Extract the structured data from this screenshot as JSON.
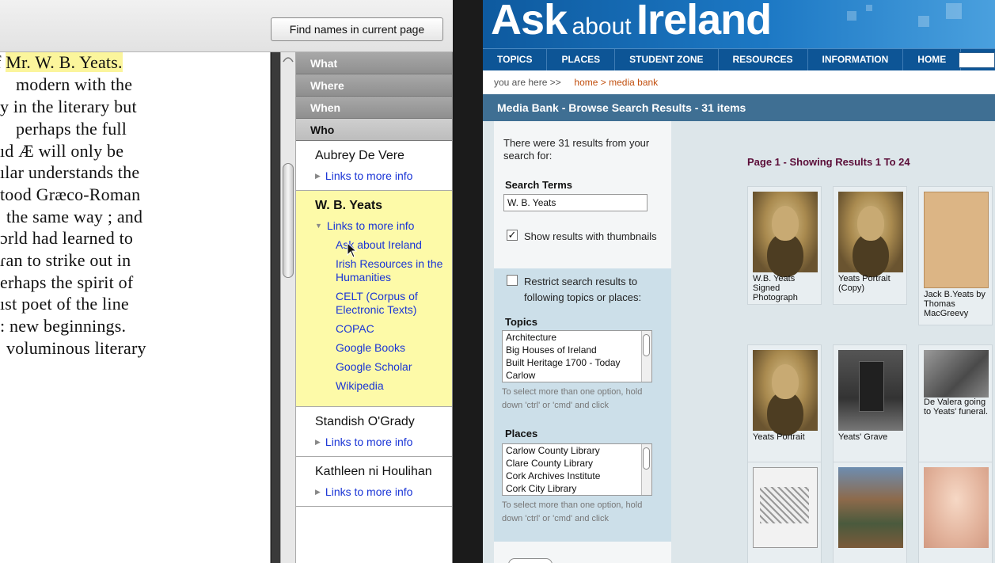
{
  "toolbar": {
    "find_button_label": "Find names in current page"
  },
  "document": {
    "highlighted_name": "Mr. W. B. Yeats.",
    "lines": [
      "f ",
      " modern with the",
      "y in the literary but",
      " perhaps the full",
      "ıd Æ will only be",
      "ılar understands the",
      "tood Græco-Roman",
      " the same way ; and",
      "ɔrld had learned to",
      "ɾan to strike out in",
      "erhaps the spirit of",
      "ıst poet of the line",
      ": new beginnings.",
      " voluminous literary"
    ]
  },
  "facets": {
    "headers": [
      "What",
      "Where",
      "When",
      "Who"
    ],
    "active": "Who",
    "names": [
      {
        "name": "Aubrey De Vere",
        "link": "Links to more info"
      },
      {
        "name": "W. B. Yeats",
        "link": "Links to more info",
        "expanded": true,
        "sublinks": [
          "Ask about Ireland",
          "Irish Resources in the Humanities",
          "CELT (Corpus of Electronic Texts)",
          "COPAC",
          "Google Books",
          "Google Scholar",
          "Wikipedia"
        ]
      },
      {
        "name": "Standish O'Grady",
        "link": "Links to more info"
      },
      {
        "name": "Kathleen ni Houlihan",
        "link": "Links to more info"
      }
    ]
  },
  "site": {
    "logo": {
      "ask": "Ask",
      "about": "about",
      "ireland": "Ireland"
    },
    "nav": [
      "TOPICS",
      "PLACES",
      "STUDENT ZONE",
      "RESOURCES",
      "INFORMATION",
      "HOME"
    ],
    "breadcrumb": {
      "prefix": "you are here >>",
      "home": "home",
      "sep": ">",
      "current": "media bank"
    },
    "results_title": "Media Bank - Browse Search Results - 31 items",
    "search": {
      "intro": "There were 31 results from your search for:",
      "terms_label": "Search Terms",
      "terms_value": "W. B. Yeats",
      "show_thumbs_label": "Show results with thumbnails",
      "show_thumbs_checked": true,
      "restrict_label": "Restrict search results to following topics or places:",
      "restrict_checked": false,
      "topics_label": "Topics",
      "topics": [
        "Architecture",
        "Big Houses of Ireland",
        "Built Heritage 1700 - Today",
        "Carlow"
      ],
      "topics_hint": "To select more than one option, hold down 'ctrl' or 'cmd' and click",
      "places_label": "Places",
      "places": [
        "Carlow County Library",
        "Clare County Library",
        "Cork Archives Institute",
        "Cork City Library"
      ],
      "places_hint": "To select more than one option, hold down 'ctrl' or 'cmd' and click"
    },
    "page_info": "Page 1 - Showing Results 1 To 24",
    "results": [
      {
        "caption": "W.B. Yeats Signed Photograph",
        "style": "sepia"
      },
      {
        "caption": "Yeats Portrait (Copy)",
        "style": "sepia"
      },
      {
        "caption": "Jack B.Yeats by Thomas MacGreevy",
        "style": "paper"
      },
      {
        "caption": "Yeats Portrait",
        "style": "sepia"
      },
      {
        "caption": "Yeats' Grave",
        "style": "grave"
      },
      {
        "caption": "De Valera going to Yeats' funeral.",
        "style": "photo-bw"
      },
      {
        "caption": "",
        "style": "sketch"
      },
      {
        "caption": "",
        "style": "crowd"
      },
      {
        "caption": "",
        "style": "portrait-pink"
      }
    ]
  }
}
